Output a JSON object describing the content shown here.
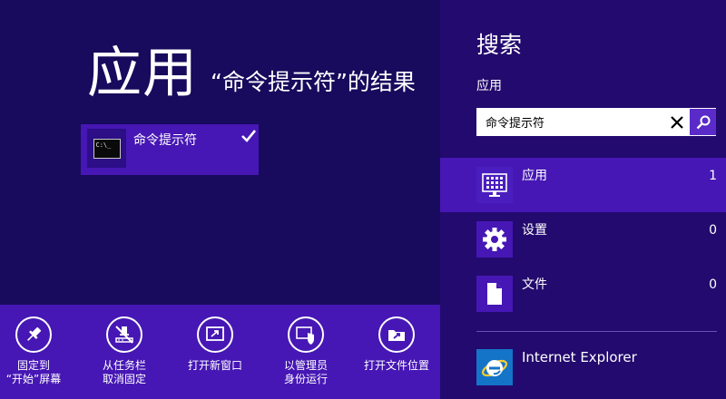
{
  "results": {
    "title": "应用",
    "subtitle": "“命令提示符”的结果",
    "items": [
      {
        "label": "命令提示符",
        "icon": "command-prompt-icon",
        "icon_text": "C:\\_",
        "selected": true
      }
    ]
  },
  "app_bar": {
    "commands": [
      {
        "label": "固定到\n“开始”屏幕",
        "icon": "pin-icon"
      },
      {
        "label": "从任务栏\n取消固定",
        "icon": "unpin-taskbar-icon"
      },
      {
        "label": "打开新窗口",
        "icon": "new-window-icon"
      },
      {
        "label": "以管理员\n身份运行",
        "icon": "run-as-admin-icon"
      },
      {
        "label": "打开文件位置",
        "icon": "open-file-location-icon"
      }
    ]
  },
  "search": {
    "title": "搜索",
    "scope_label": "应用",
    "query": "命令提示符",
    "scopes": [
      {
        "name": "应用",
        "count": "1",
        "icon": "apps-icon",
        "selected": true
      },
      {
        "name": "设置",
        "count": "0",
        "icon": "settings-gear-icon",
        "selected": false
      },
      {
        "name": "文件",
        "count": "0",
        "icon": "file-icon",
        "selected": false
      }
    ],
    "apps": [
      {
        "name": "Internet Explorer",
        "icon": "internet-explorer-icon"
      }
    ]
  },
  "colors": {
    "background": "#180a5c",
    "charm_background": "#230a6e",
    "accent": "#4617b4",
    "search_button": "#5a2bc8"
  }
}
